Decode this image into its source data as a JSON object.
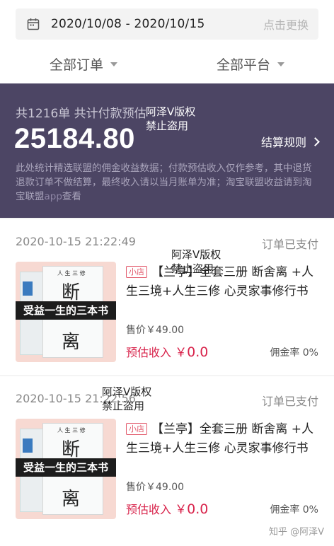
{
  "filter_bar": {
    "date_range": "2020/10/08 - 2020/10/15",
    "change_label": "点击更换",
    "orders_filter": "全部订单",
    "platform_filter": "全部平台"
  },
  "summary": {
    "count_text": "共1216单 共计付款预估",
    "amount": "25184.80",
    "rules_label": "结算规则",
    "note": "此处统计精选联盟的佣金收益数据；付款预估收入仅作参考，其中退货退款订单不做结算，最终收入请以当月账单为准；淘宝联盟收益请到淘宝联盟",
    "note_link": "app",
    "note_tail": "查看"
  },
  "watermark": {
    "line1": "阿泽V版权",
    "line2": "禁止盗用"
  },
  "orders": [
    {
      "time": "2020-10-15 21:22:49",
      "status": "订单已支付",
      "shop_tag": "小店",
      "title": "【兰亭】全套三册 断舍离 +人生三境+人生三修 心灵家事修行书",
      "price": "售价￥49.00",
      "est_label": "预估收入",
      "est_currency": "￥",
      "est_value": "0.0",
      "rate": "佣金率 0%",
      "cover_ribbon": "受益一生的三本书",
      "cover_big_char1": "断",
      "cover_big_char2": "离",
      "cover_small": "人 生 三 修"
    },
    {
      "time": "2020-10-15 21:22:56",
      "status": "订单已支付",
      "shop_tag": "小店",
      "title": "【兰亭】全套三册 断舍离 +人生三境+人生三修 心灵家事修行书",
      "price": "售价￥49.00",
      "est_label": "预估收入",
      "est_currency": "￥",
      "est_value": "0.0",
      "rate": "佣金率 0%",
      "cover_ribbon": "受益一生的三本书",
      "cover_big_char1": "断",
      "cover_big_char2": "离",
      "cover_small": "人 生 三 修"
    }
  ],
  "footer_watermark": "知乎 @阿泽V",
  "colors": {
    "summary_bg": "#4c4564",
    "accent_red": "#d8224a"
  }
}
